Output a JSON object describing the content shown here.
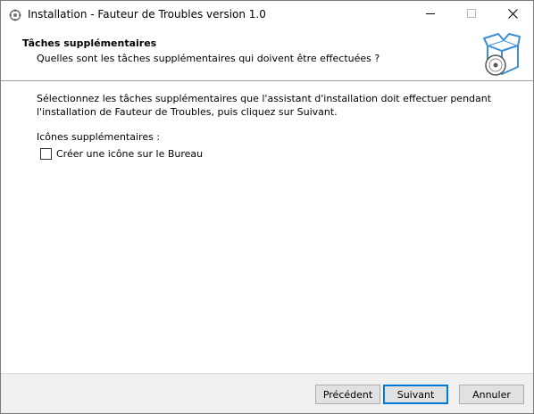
{
  "window": {
    "title": "Installation - Fauteur de Troubles version 1.0"
  },
  "titlebar": {
    "minimize_icon": "minimize-icon",
    "maximize_icon": "maximize-icon",
    "close_icon": "close-icon"
  },
  "header": {
    "title": "Tâches supplémentaires",
    "subtitle": "Quelles sont les tâches supplémentaires qui doivent être effectuées ?",
    "image_icon": "installer-box-disc-icon"
  },
  "body": {
    "description": "Sélectionnez les tâches supplémentaires que l'assistant d'installation doit effectuer pendant l'installation de Fauteur de Troubles, puis cliquez sur Suivant.",
    "group_label": "Icônes supplémentaires :",
    "tasks": [
      {
        "label": "Créer une icône sur le Bureau",
        "checked": false
      }
    ]
  },
  "footer": {
    "back_label": "Précédent",
    "next_label": "Suivant",
    "cancel_label": "Annuler"
  },
  "colors": {
    "accent": "#0078d7",
    "footer_bg": "#f0f0f0",
    "button_bg": "#e1e1e1"
  }
}
